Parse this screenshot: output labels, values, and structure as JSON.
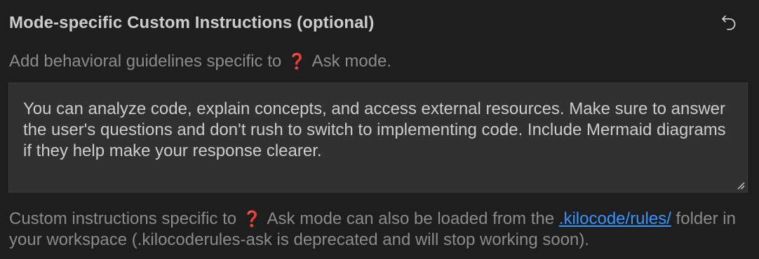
{
  "section": {
    "title": "Mode-specific Custom Instructions (optional)",
    "subtitle_prefix": "Add behavioral guidelines specific to",
    "mode_emoji": "❓",
    "mode_name": "Ask mode.",
    "reset_icon": "undo-icon"
  },
  "instructions": {
    "value": "You can analyze code, explain concepts, and access external resources. Make sure to answer the user's questions and don't rush to switch to implementing code. Include Mermaid diagrams if they help make your response clearer."
  },
  "footer": {
    "prefix": "Custom instructions specific to",
    "mode_emoji": "❓",
    "middle": "Ask mode can also be loaded from the",
    "link_text": ".kilocode/rules/",
    "suffix": "folder in your workspace (.kilocoderules-ask is deprecated and will stop working soon)."
  },
  "colors": {
    "background": "#1e1e1e",
    "textarea_bg": "#313131",
    "link": "#3794ff",
    "emoji_red": "#e0302d"
  }
}
